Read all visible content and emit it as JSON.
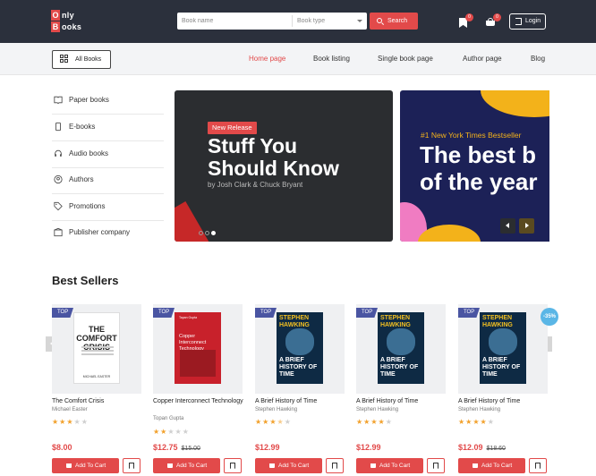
{
  "header": {
    "logo_line1": "nly",
    "logo_line2": "ooks",
    "logo_letter1": "O",
    "logo_letter2": "B",
    "search_placeholder": "Book name",
    "type_placeholder": "Book type",
    "search_label": "Search",
    "wishlist_count": "0",
    "cart_count": "0",
    "login_label": "Login"
  },
  "nav": {
    "all_books": "All Books",
    "links": [
      "Home page",
      "Book listing",
      "Single book page",
      "Author page",
      "Blog"
    ],
    "active": "Home page"
  },
  "sidebar": {
    "items": [
      {
        "label": "Paper books",
        "icon": "book-open-icon"
      },
      {
        "label": "E-books",
        "icon": "tablet-icon"
      },
      {
        "label": "Audio books",
        "icon": "headphones-icon"
      },
      {
        "label": "Authors",
        "icon": "user-icon"
      },
      {
        "label": "Promotions",
        "icon": "tag-icon"
      },
      {
        "label": "Publisher company",
        "icon": "building-icon"
      }
    ]
  },
  "hero": {
    "slide1": {
      "tag": "New Release",
      "title_line1": "Stuff You",
      "title_line2": "Should Know",
      "subtitle": "by Josh Clark & Chuck Bryant"
    },
    "slide2": {
      "tag": "#1 New York Times Bestseller",
      "title_line1": "The best b",
      "title_line2": "of the year"
    }
  },
  "bestsellers": {
    "title": "Best Sellers",
    "tag": "TOP",
    "add_to_cart": "Add To Cart",
    "items": [
      {
        "title": "The Comfort Crisis",
        "author": "Michael Easter",
        "rating": 3,
        "price": "$8.00",
        "old_price": "",
        "discount": "",
        "cover_title": "THE COMFORT CRISIS",
        "cover_author": "MICHAEL EASTER"
      },
      {
        "title": "Copper Interconnect Technology",
        "author": "Topan Gupta",
        "rating": 2,
        "price": "$12.75",
        "old_price": "$15.00",
        "discount": "",
        "cover_title": "Copper Interconnect Technology",
        "cover_small": "Tapan Gupta"
      },
      {
        "title": "A Brief History of Time",
        "author": "Stephen Hawking",
        "rating": 3.5,
        "price": "$12.99",
        "old_price": "",
        "discount": "",
        "cover_author": "STEPHEN HAWKING",
        "cover_title": "A BRIEF HISTORY OF TIME"
      },
      {
        "title": "A Brief History of Time",
        "author": "Stephen Hawking",
        "rating": 4,
        "price": "$12.99",
        "old_price": "",
        "discount": "",
        "cover_author": "STEPHEN HAWKING",
        "cover_title": "A BRIEF HISTORY OF TIME"
      },
      {
        "title": "A Brief History of Time",
        "author": "Stephen Hawking",
        "rating": 4,
        "price": "$12.09",
        "old_price": "$18.60",
        "discount": "-35%",
        "cover_author": "STEPHEN HAWKING",
        "cover_title": "A BRIEF HISTORY OF TIME"
      }
    ]
  },
  "colors": {
    "accent": "#e24a4a",
    "header_bg": "#2b303c",
    "tag_bg": "#4a55a2",
    "star": "#f2a12c"
  }
}
